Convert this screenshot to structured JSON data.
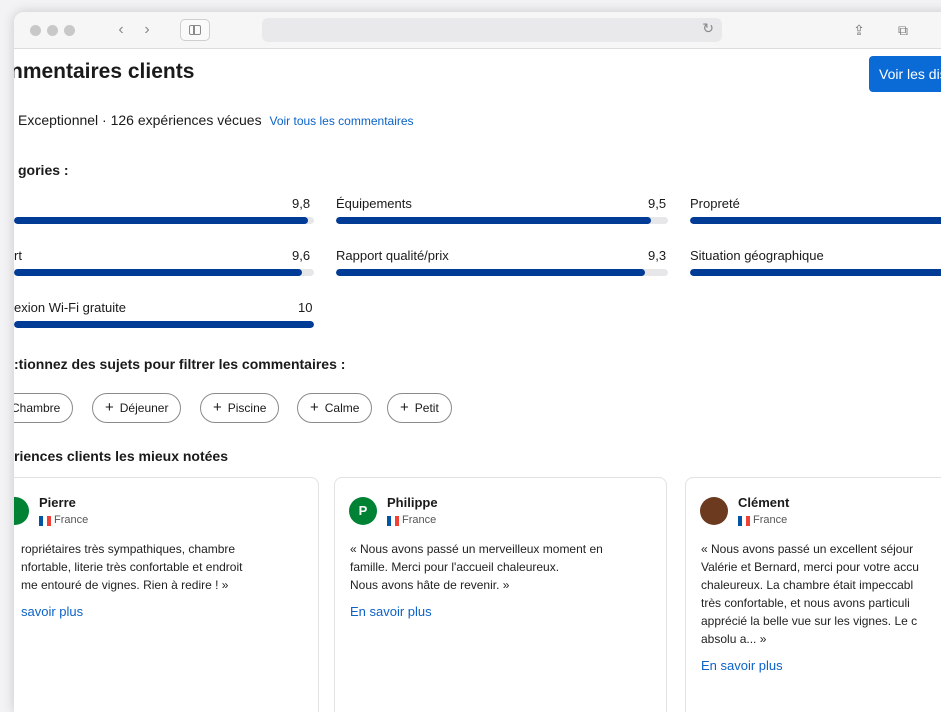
{
  "browser": {
    "back_glyph": "‹",
    "forward_glyph": "›",
    "reload_glyph": "↻",
    "share_glyph": "⇪",
    "tabs_glyph": "⧉"
  },
  "page": {
    "title": "nmentaires clients",
    "cta_label": "Voir les dis",
    "summary_text": "Exceptionnel · 126 expériences vécues",
    "see_all_link": "Voir tous les commentaires",
    "categories_heading": "gories :",
    "filter_heading": ":tionnez des sujets pour filtrer les commentaires :",
    "best_heading": "riences clients les mieux notées"
  },
  "categories": [
    {
      "label": "",
      "score": "9,8",
      "fraction": 0.98
    },
    {
      "label": "Équipements",
      "score": "9,5",
      "fraction": 0.95
    },
    {
      "label": "Propreté",
      "score": "",
      "fraction": 1.0
    },
    {
      "label": "rt",
      "score": "9,6",
      "fraction": 0.96
    },
    {
      "label": "Rapport qualité/prix",
      "score": "9,3",
      "fraction": 0.93
    },
    {
      "label": "Situation géographique",
      "score": "",
      "fraction": 1.0
    },
    {
      "label": "exion Wi-Fi gratuite",
      "score": "10",
      "fraction": 1.0
    }
  ],
  "chips": [
    {
      "plus": "",
      "label": "Chambre"
    },
    {
      "plus": "+",
      "label": "Déjeuner"
    },
    {
      "plus": "+",
      "label": "Piscine"
    },
    {
      "plus": "+",
      "label": "Calme"
    },
    {
      "plus": "+",
      "label": "Petit"
    }
  ],
  "reviews": [
    {
      "initial": "",
      "name": "Pierre",
      "country": "France",
      "text": "ropriétaires très sympathiques, chambre\nnfortable, literie très confortable et endroit\nme entouré de vignes. Rien à redire ! »",
      "more": "savoir plus",
      "avatar_color": "#008234"
    },
    {
      "initial": "P",
      "name": "Philippe",
      "country": "France",
      "text": "« Nous avons passé un merveilleux moment en\nfamille. Merci pour l'accueil chaleureux.\nNous avons hâte de revenir. »",
      "more": "En savoir plus",
      "avatar_color": "#008234"
    },
    {
      "initial": "",
      "name": "Clément",
      "country": "France",
      "text": "« Nous avons passé un excellent séjour\nValérie et Bernard, merci pour votre accu\nchaleureux. La chambre était impeccabl\ntrès confortable, et nous avons particuli\napprécié la belle vue sur les vignes. Le c\nabsolu a... »",
      "more": "En savoir plus",
      "avatar_color": "#6b3a1f"
    }
  ],
  "colors": {
    "accent": "#0b6bd6",
    "bar": "#003b95",
    "link": "#0b62c7"
  }
}
